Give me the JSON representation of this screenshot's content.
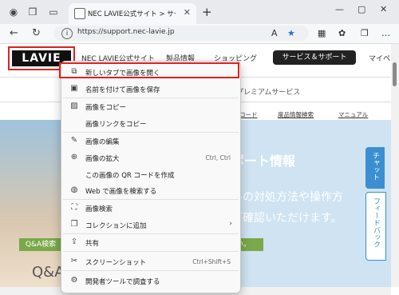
{
  "browser": {
    "tab_title": "NEC LAVIE公式サイト > サービス＆サ",
    "url": "https://support.nec-lavie.jp"
  },
  "site": {
    "logo": "LAVIE",
    "nav": [
      "NEC LAVIE公式サイト",
      "製品情報",
      "ショッピング",
      "サービス＆サポート",
      "マイペ"
    ],
    "sub_nav": "プレミアムサービス",
    "sub_links": [
      "ロード",
      "度品情報検索",
      "マニュアル"
    ],
    "hero_title": "ポート情報",
    "hero_line1": "ルの対処方法や操作方",
    "hero_line2": "ご確認いただけます。",
    "qa_badge": "Q&A検索",
    "qa_text": "Q&A",
    "green_button": "い。",
    "side_chat": "チャット",
    "side_feedback": "フィードバック"
  },
  "context_menu": {
    "items": [
      {
        "label": "新しいタブで画像を開く",
        "icon": "new-tab-icon"
      },
      {
        "label": "名前を付けて画像を保存",
        "icon": "save-icon"
      },
      {
        "label": "画像をコピー",
        "icon": "copy-image-icon"
      },
      {
        "label": "画像リンクをコピー",
        "icon": ""
      },
      {
        "label": "画像の編集",
        "icon": "edit-image-icon"
      },
      {
        "label": "画像の拡大",
        "icon": "zoom-icon",
        "shortcut": "Ctrl, Ctrl"
      },
      {
        "label": "この画像の QR コードを作成",
        "icon": ""
      },
      {
        "label": "Web で画像を検索する",
        "icon": "web-search-icon"
      },
      {
        "label": "画像検索",
        "icon": "visual-search-icon"
      },
      {
        "label": "コレクションに追加",
        "icon": "collections-icon",
        "submenu": true
      },
      {
        "label": "共有",
        "icon": "share-icon"
      },
      {
        "label": "スクリーンショット",
        "icon": "screenshot-icon",
        "shortcut": "Ctrl+Shift+S"
      },
      {
        "label": "開発者ツールで調査する",
        "icon": "devtools-icon"
      }
    ]
  },
  "colors": {
    "highlight": "#e02020",
    "accent": "#3b8fd0",
    "green": "#7aa84a"
  }
}
